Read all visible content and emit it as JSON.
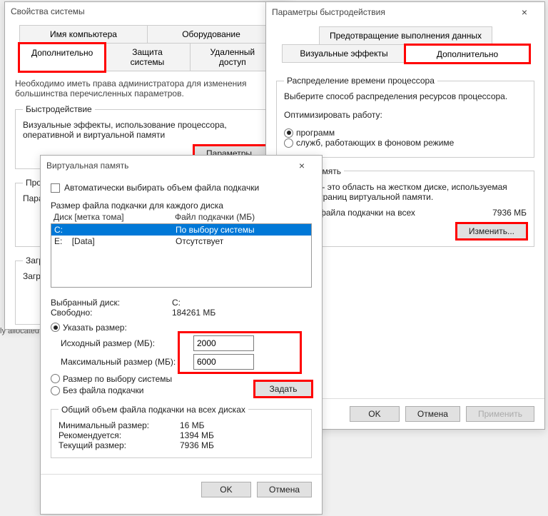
{
  "sysprops": {
    "title": "Свойства системы",
    "tabs_row1": [
      "Имя компьютера",
      "Оборудование"
    ],
    "tabs_row2": [
      "Дополнительно",
      "Защита системы",
      "Удаленный доступ"
    ],
    "admin_note": "Необходимо иметь права администратора для изменения большинства перечисленных параметров.",
    "perf_legend": "Быстродействие",
    "perf_text": "Визуальные эффекты, использование процессора, оперативной и виртуальной памяти",
    "perf_btn": "Параметры...",
    "profiles_legend": "Профили пользователей",
    "profiles_text": "Пара",
    "startup_legend": "Загр",
    "startup_text": "Загр"
  },
  "perfopts": {
    "title": "Параметры быстродействия",
    "tabs_row1": [
      "Предотвращение выполнения данных"
    ],
    "tabs_row2": [
      "Визуальные эффекты",
      "Дополнительно"
    ],
    "sched_legend": "Распределение времени процессора",
    "sched_text": "Выберите способ распределения ресурсов процессора.",
    "opt_label": "Оптимизировать работу:",
    "opt_programs": "программ",
    "opt_services": "служб, работающих в фоновом режиме",
    "vm_legend": "льная память",
    "vm_text1": "подкачки - это область на жестком диске, используемая",
    "vm_text2": "анения страниц виртуальной памяти.",
    "vm_total_label": "й объем файла подкачки на всех",
    "vm_total_value": "7936 МБ",
    "vm_change_btn": "Изменить...",
    "ok": "OK",
    "cancel": "Отмена",
    "apply": "Применить"
  },
  "vmem": {
    "title": "Виртуальная память",
    "auto_label": "Автоматически выбирать объем файла подкачки",
    "perdisk_label": "Размер файла подкачки для каждого диска",
    "col_drive": "Диск [метка тома]",
    "col_pf": "Файл подкачки (МБ)",
    "rows": [
      {
        "drive": "C:",
        "label": "",
        "pf": "По выбору системы",
        "selected": true
      },
      {
        "drive": "E:",
        "label": "[Data]",
        "pf": "Отсутствует",
        "selected": false
      }
    ],
    "sel_drive_label": "Выбранный диск:",
    "sel_drive_value": "C:",
    "free_label": "Свободно:",
    "free_value": "184261 МБ",
    "custom_label": "Указать размер:",
    "initial_label": "Исходный размер (МБ):",
    "initial_value": "2000",
    "max_label": "Максимальный размер (МБ):",
    "max_value": "6000",
    "sysmanaged_label": "Размер по выбору системы",
    "nopf_label": "Без файла подкачки",
    "set_btn": "Задать",
    "total_legend": "Общий объем файла подкачки на всех дисках",
    "min_label": "Минимальный размер:",
    "min_value": "16 МБ",
    "rec_label": "Рекомендуется:",
    "rec_value": "1394 МБ",
    "cur_label": "Текущий размер:",
    "cur_value": "7936 МБ",
    "ok": "OK",
    "cancel": "Отмена"
  },
  "passthru": "ly allocated"
}
